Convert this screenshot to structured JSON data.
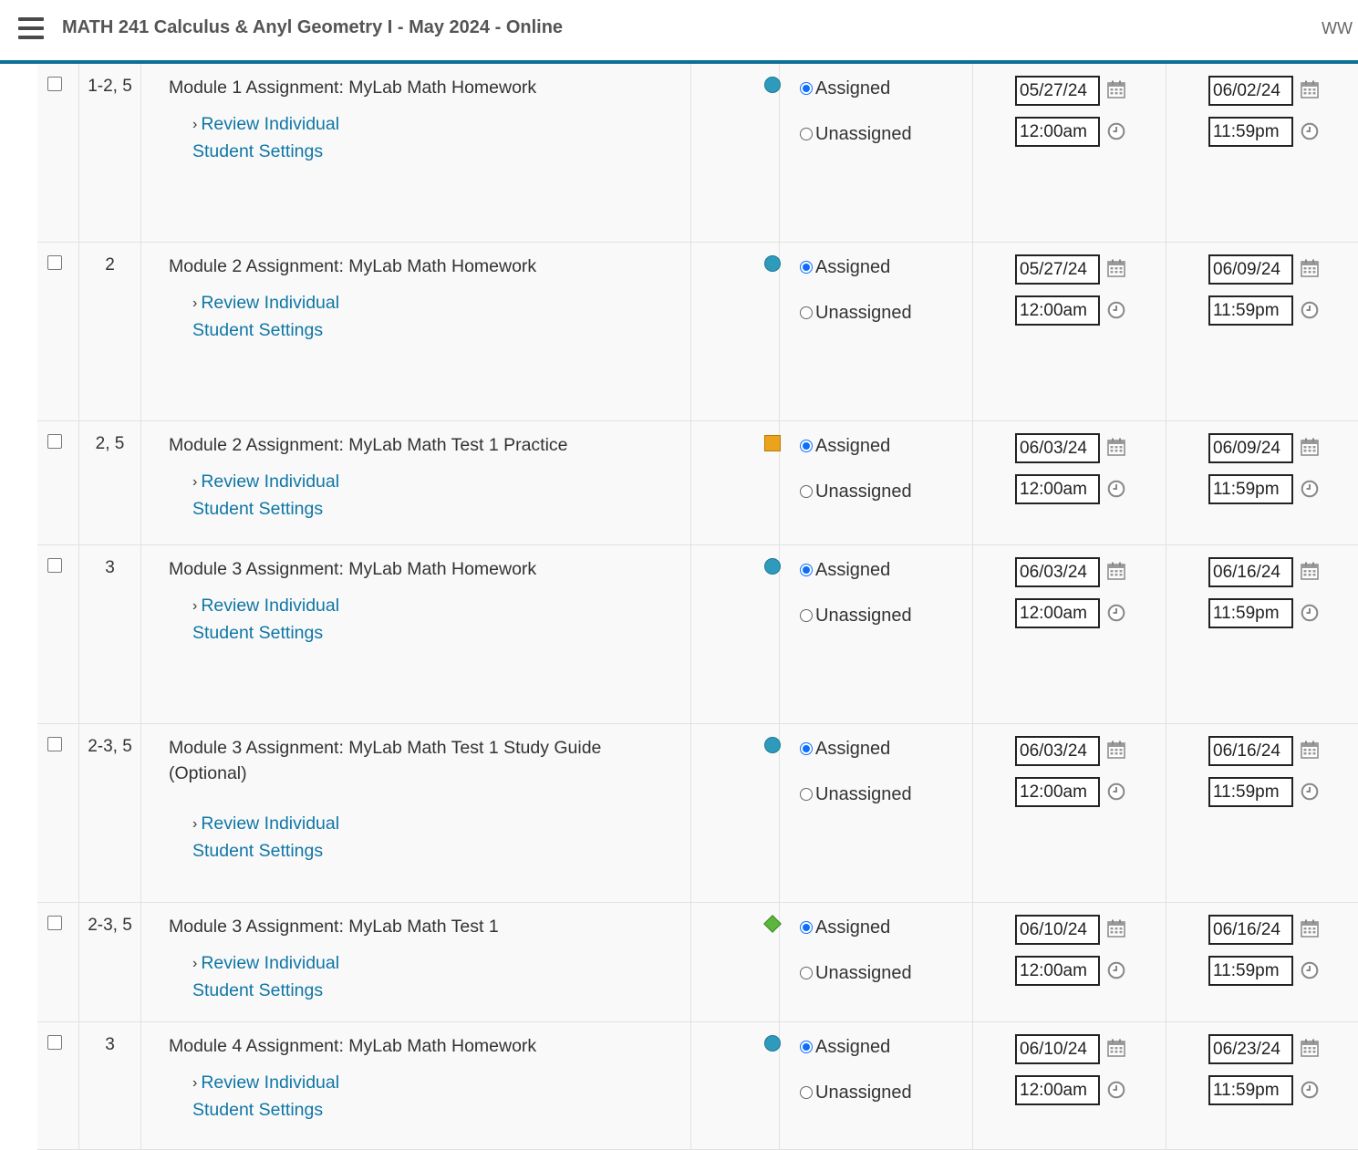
{
  "header": {
    "course_title": "MATH 241 Calculus & Anyl Geometry I - May 2024 - Online",
    "user_initials": "WW"
  },
  "status_options": {
    "assigned": "Assigned",
    "unassigned": "Unassigned"
  },
  "review_link": {
    "line1": "Review Individual",
    "line2": "Student Settings"
  },
  "colors": {
    "accent": "#0f7097",
    "homework": "#2e9bbd",
    "practice": "#eba31c",
    "test": "#5bb53e",
    "link": "#0f76a6"
  },
  "assignments": [
    {
      "chapters": "1-2, 5",
      "title": "Module 1 Assignment: MyLab Math Homework",
      "type_icon": "homework-circle-icon",
      "status": "Assigned",
      "start_date": "05/27/24",
      "start_time": "12:00am",
      "due_date": "06/02/24",
      "due_time": "11:59pm"
    },
    {
      "chapters": "2",
      "title": "Module 2 Assignment: MyLab Math Homework",
      "type_icon": "homework-circle-icon",
      "status": "Assigned",
      "start_date": "05/27/24",
      "start_time": "12:00am",
      "due_date": "06/09/24",
      "due_time": "11:59pm"
    },
    {
      "chapters": "2, 5",
      "title": "Module 2 Assignment: MyLab Math Test 1 Practice",
      "type_icon": "practice-square-icon",
      "status": "Assigned",
      "start_date": "06/03/24",
      "start_time": "12:00am",
      "due_date": "06/09/24",
      "due_time": "11:59pm"
    },
    {
      "chapters": "3",
      "title": "Module 3 Assignment: MyLab Math Homework",
      "type_icon": "homework-circle-icon",
      "status": "Assigned",
      "start_date": "06/03/24",
      "start_time": "12:00am",
      "due_date": "06/16/24",
      "due_time": "11:59pm"
    },
    {
      "chapters": "2-3, 5",
      "title": "Module 3 Assignment: MyLab Math Test 1 Study Guide (Optional)",
      "type_icon": "homework-circle-icon",
      "status": "Assigned",
      "start_date": "06/03/24",
      "start_time": "12:00am",
      "due_date": "06/16/24",
      "due_time": "11:59pm"
    },
    {
      "chapters": "2-3, 5",
      "title": "Module 3 Assignment: MyLab Math Test 1",
      "type_icon": "test-diamond-icon",
      "status": "Assigned",
      "start_date": "06/10/24",
      "start_time": "12:00am",
      "due_date": "06/16/24",
      "due_time": "11:59pm"
    },
    {
      "chapters": "3",
      "title": "Module 4 Assignment: MyLab Math Homework",
      "type_icon": "homework-circle-icon",
      "status": "Assigned",
      "start_date": "06/10/24",
      "start_time": "12:00am",
      "due_date": "06/23/24",
      "due_time": "11:59pm"
    }
  ]
}
